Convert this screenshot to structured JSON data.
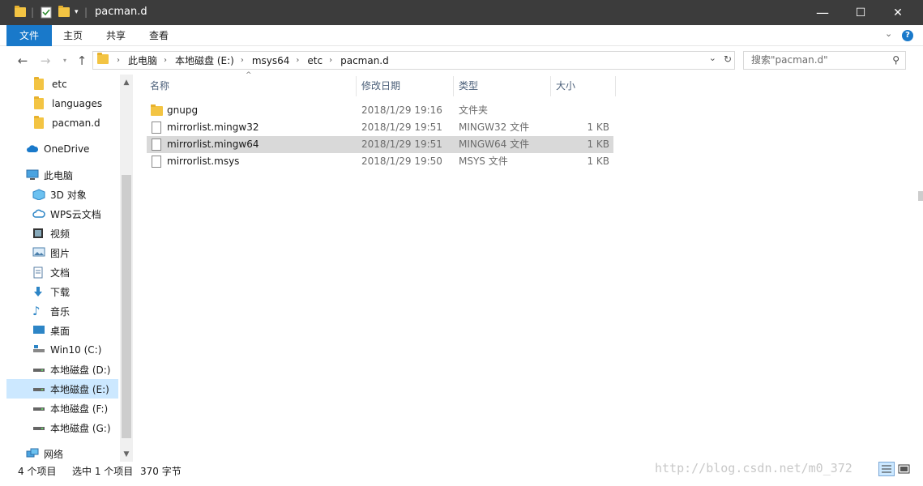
{
  "window": {
    "title": "pacman.d",
    "controls": {
      "minimize": "—",
      "maximize": "☐",
      "close": "✕"
    }
  },
  "ribbon": {
    "tabs": [
      "文件",
      "主页",
      "共享",
      "查看"
    ],
    "expand_icon": "chevron-down-icon",
    "help_icon": "help-icon"
  },
  "address": {
    "crumbs": [
      "此电脑",
      "本地磁盘 (E:)",
      "msys64",
      "etc",
      "pacman.d"
    ]
  },
  "search": {
    "placeholder": "搜索\"pacman.d\""
  },
  "sidebar": {
    "items": [
      {
        "label": "etc",
        "icon": "folder-icon"
      },
      {
        "label": "languages",
        "icon": "folder-icon"
      },
      {
        "label": "pacman.d",
        "icon": "folder-icon"
      },
      {
        "label": "OneDrive",
        "icon": "cloud-icon"
      },
      {
        "label": "此电脑",
        "icon": "computer-icon"
      },
      {
        "label": "3D 对象",
        "icon": "cube-icon"
      },
      {
        "label": "WPS云文档",
        "icon": "wps-cloud-icon"
      },
      {
        "label": "视频",
        "icon": "video-icon"
      },
      {
        "label": "图片",
        "icon": "picture-icon"
      },
      {
        "label": "文档",
        "icon": "document-icon"
      },
      {
        "label": "下载",
        "icon": "download-icon"
      },
      {
        "label": "音乐",
        "icon": "music-icon"
      },
      {
        "label": "桌面",
        "icon": "desktop-icon"
      },
      {
        "label": "Win10 (C:)",
        "icon": "drive-icon"
      },
      {
        "label": "本地磁盘 (D:)",
        "icon": "drive-icon"
      },
      {
        "label": "本地磁盘 (E:)",
        "icon": "drive-icon",
        "selected": true
      },
      {
        "label": "本地磁盘 (F:)",
        "icon": "drive-icon"
      },
      {
        "label": "本地磁盘 (G:)",
        "icon": "drive-icon"
      },
      {
        "label": "网络",
        "icon": "network-icon"
      }
    ]
  },
  "columns": [
    "名称",
    "修改日期",
    "类型",
    "大小"
  ],
  "files": [
    {
      "name": "gnupg",
      "date": "2018/1/29 19:16",
      "type": "文件夹",
      "size": "",
      "kind": "folder"
    },
    {
      "name": "mirrorlist.mingw32",
      "date": "2018/1/29 19:51",
      "type": "MINGW32 文件",
      "size": "1 KB",
      "kind": "file"
    },
    {
      "name": "mirrorlist.mingw64",
      "date": "2018/1/29 19:51",
      "type": "MINGW64 文件",
      "size": "1 KB",
      "kind": "file",
      "selected": true
    },
    {
      "name": "mirrorlist.msys",
      "date": "2018/1/29 19:50",
      "type": "MSYS 文件",
      "size": "1 KB",
      "kind": "file"
    }
  ],
  "status": {
    "count": "4 个项目",
    "selection": "选中 1 个项目",
    "size": "370 字节"
  },
  "watermark": "http://blog.csdn.net/m0_372",
  "colors": {
    "accent": "#1979ca",
    "titlebar": "#3c3c3c",
    "selected_row": "#d9d9d9",
    "selected_nav": "#cce8ff"
  }
}
